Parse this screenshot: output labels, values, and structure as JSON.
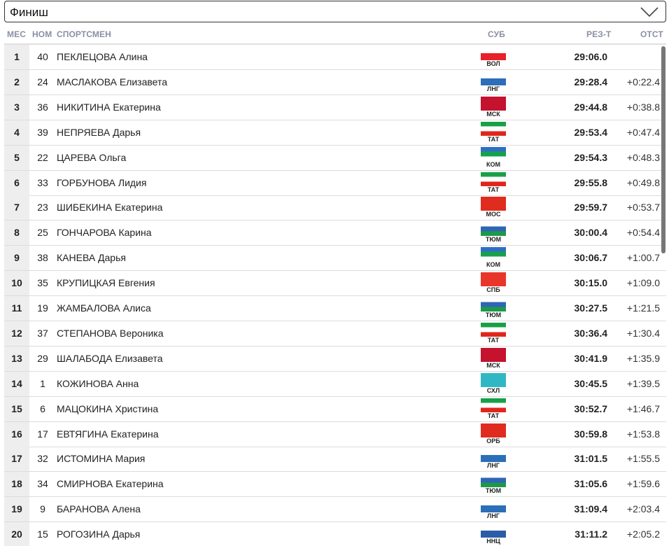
{
  "filter": {
    "selected": "Финиш"
  },
  "columns": {
    "place": "МЕС",
    "bib": "НОМ",
    "athlete": "СПОРТСМЕН",
    "region": "СУБ",
    "result": "РЕЗ-Т",
    "gap": "ОТСТ"
  },
  "flag_colors": {
    "ВОЛ": [
      "#ffffff",
      "#e8202a"
    ],
    "ЛНГ": [
      "#ffffff",
      "#2c6fb8"
    ],
    "МСК": [
      "#c4122f"
    ],
    "ТАТ": [
      "#18a047",
      "#ffffff",
      "#e1251b"
    ],
    "КОМ": [
      "#2e6fc5",
      "#17a04b",
      "#ffffff"
    ],
    "МОС": [
      "#e02b1f"
    ],
    "ТЮМ": [
      "#ffffff",
      "#2f66b5",
      "#1c9a4a"
    ],
    "СПБ": [
      "#e8362b"
    ],
    "СХЛ": [
      "#2fb8c4"
    ],
    "ОРБ": [
      "#e02c1f"
    ],
    "ННЦ": [
      "#ffffff",
      "#2a5ca8"
    ]
  },
  "results": [
    {
      "place": "1",
      "bib": "40",
      "name": "ПЕКЛЕЦОВА Алина",
      "region": "ВОЛ",
      "result": "29:06.0",
      "gap": ""
    },
    {
      "place": "2",
      "bib": "24",
      "name": "МАСЛАКОВА Елизавета",
      "region": "ЛНГ",
      "result": "29:28.4",
      "gap": "+0:22.4"
    },
    {
      "place": "3",
      "bib": "36",
      "name": "НИКИТИНА Екатерина",
      "region": "МСК",
      "result": "29:44.8",
      "gap": "+0:38.8"
    },
    {
      "place": "4",
      "bib": "39",
      "name": "НЕПРЯЕВА Дарья",
      "region": "ТАТ",
      "result": "29:53.4",
      "gap": "+0:47.4"
    },
    {
      "place": "5",
      "bib": "22",
      "name": "ЦАРЕВА Ольга",
      "region": "КОМ",
      "result": "29:54.3",
      "gap": "+0:48.3"
    },
    {
      "place": "6",
      "bib": "33",
      "name": "ГОРБУНОВА Лидия",
      "region": "ТАТ",
      "result": "29:55.8",
      "gap": "+0:49.8"
    },
    {
      "place": "7",
      "bib": "23",
      "name": "ШИБЕКИНА Екатерина",
      "region": "МОС",
      "result": "29:59.7",
      "gap": "+0:53.7"
    },
    {
      "place": "8",
      "bib": "25",
      "name": "ГОНЧАРОВА Карина",
      "region": "ТЮМ",
      "result": "30:00.4",
      "gap": "+0:54.4"
    },
    {
      "place": "9",
      "bib": "38",
      "name": "КАНЕВА Дарья",
      "region": "КОМ",
      "result": "30:06.7",
      "gap": "+1:00.7"
    },
    {
      "place": "10",
      "bib": "35",
      "name": "КРУПИЦКАЯ Евгения",
      "region": "СПБ",
      "result": "30:15.0",
      "gap": "+1:09.0"
    },
    {
      "place": "11",
      "bib": "19",
      "name": "ЖАМБАЛОВА Алиса",
      "region": "ТЮМ",
      "result": "30:27.5",
      "gap": "+1:21.5"
    },
    {
      "place": "12",
      "bib": "37",
      "name": "СТЕПАНОВА Вероника",
      "region": "ТАТ",
      "result": "30:36.4",
      "gap": "+1:30.4"
    },
    {
      "place": "13",
      "bib": "29",
      "name": "ШАЛАБОДА Елизавета",
      "region": "МСК",
      "result": "30:41.9",
      "gap": "+1:35.9"
    },
    {
      "place": "14",
      "bib": "1",
      "name": "КОЖИНОВА Анна",
      "region": "СХЛ",
      "result": "30:45.5",
      "gap": "+1:39.5"
    },
    {
      "place": "15",
      "bib": "6",
      "name": "МАЦОКИНА Христина",
      "region": "ТАТ",
      "result": "30:52.7",
      "gap": "+1:46.7"
    },
    {
      "place": "16",
      "bib": "17",
      "name": "ЕВТЯГИНА Екатерина",
      "region": "ОРБ",
      "result": "30:59.8",
      "gap": "+1:53.8"
    },
    {
      "place": "17",
      "bib": "32",
      "name": "ИСТОМИНА Мария",
      "region": "ЛНГ",
      "result": "31:01.5",
      "gap": "+1:55.5"
    },
    {
      "place": "18",
      "bib": "34",
      "name": "СМИРНОВА Екатерина",
      "region": "ТЮМ",
      "result": "31:05.6",
      "gap": "+1:59.6"
    },
    {
      "place": "19",
      "bib": "9",
      "name": "БАРАНОВА Алена",
      "region": "ЛНГ",
      "result": "31:09.4",
      "gap": "+2:03.4"
    },
    {
      "place": "20",
      "bib": "15",
      "name": "РОГОЗИНА Дарья",
      "region": "ННЦ",
      "result": "31:11.2",
      "gap": "+2:05.2"
    }
  ]
}
